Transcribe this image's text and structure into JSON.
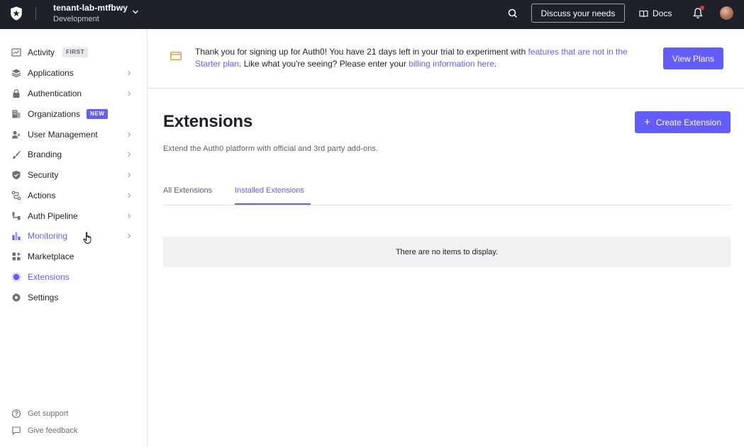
{
  "topbar": {
    "tenant_name": "tenant-lab-mtfbwy",
    "tenant_env": "Development",
    "discuss_label": "Discuss your needs",
    "docs_label": "Docs",
    "notification_dot_color": "#e0392c"
  },
  "sidebar": {
    "items": [
      {
        "label": "Activity",
        "icon": "activity-icon",
        "badge": "FIRST",
        "chevron": false,
        "active": false
      },
      {
        "label": "Applications",
        "icon": "layers-icon",
        "chevron": true,
        "active": false
      },
      {
        "label": "Authentication",
        "icon": "lock-icon",
        "chevron": true,
        "active": false
      },
      {
        "label": "Organizations",
        "icon": "building-icon",
        "badge": "NEW",
        "chevron": false,
        "active": false
      },
      {
        "label": "User Management",
        "icon": "users-icon",
        "chevron": true,
        "active": false
      },
      {
        "label": "Branding",
        "icon": "brush-icon",
        "chevron": true,
        "active": false
      },
      {
        "label": "Security",
        "icon": "shield-icon",
        "chevron": true,
        "active": false
      },
      {
        "label": "Actions",
        "icon": "flow-icon",
        "chevron": true,
        "active": false
      },
      {
        "label": "Auth Pipeline",
        "icon": "pipeline-icon",
        "chevron": true,
        "active": false
      },
      {
        "label": "Monitoring",
        "icon": "bar-chart-icon",
        "chevron": true,
        "active": true
      },
      {
        "label": "Marketplace",
        "icon": "grid-plus-icon",
        "chevron": false,
        "active": false
      },
      {
        "label": "Extensions",
        "icon": "extensions-icon",
        "chevron": false,
        "active": true
      },
      {
        "label": "Settings",
        "icon": "gear-icon",
        "chevron": false,
        "active": false
      }
    ],
    "footer": [
      {
        "label": "Get support",
        "icon": "help-icon"
      },
      {
        "label": "Give feedback",
        "icon": "feedback-icon"
      }
    ]
  },
  "banner": {
    "text_1": "Thank you for signing up for Auth0! You have 21 days left in your trial to experiment with ",
    "link_1": "features that are not in the Starter plan",
    "text_2": ". Like what you're seeing? Please enter your ",
    "link_2": "billing information here",
    "text_3": ".",
    "button_label": "View Plans"
  },
  "main": {
    "title": "Extensions",
    "subtitle": "Extend the Auth0 platform with official and 3rd party add-ons.",
    "create_label": "Create Extension",
    "tabs": [
      {
        "label": "All Extensions",
        "active": false
      },
      {
        "label": "Installed Extensions",
        "active": true
      }
    ],
    "empty_message": "There are no items to display."
  },
  "colors": {
    "accent": "#635dff",
    "topbar_bg": "#1e212a",
    "banner_icon": "#d99a2b"
  }
}
